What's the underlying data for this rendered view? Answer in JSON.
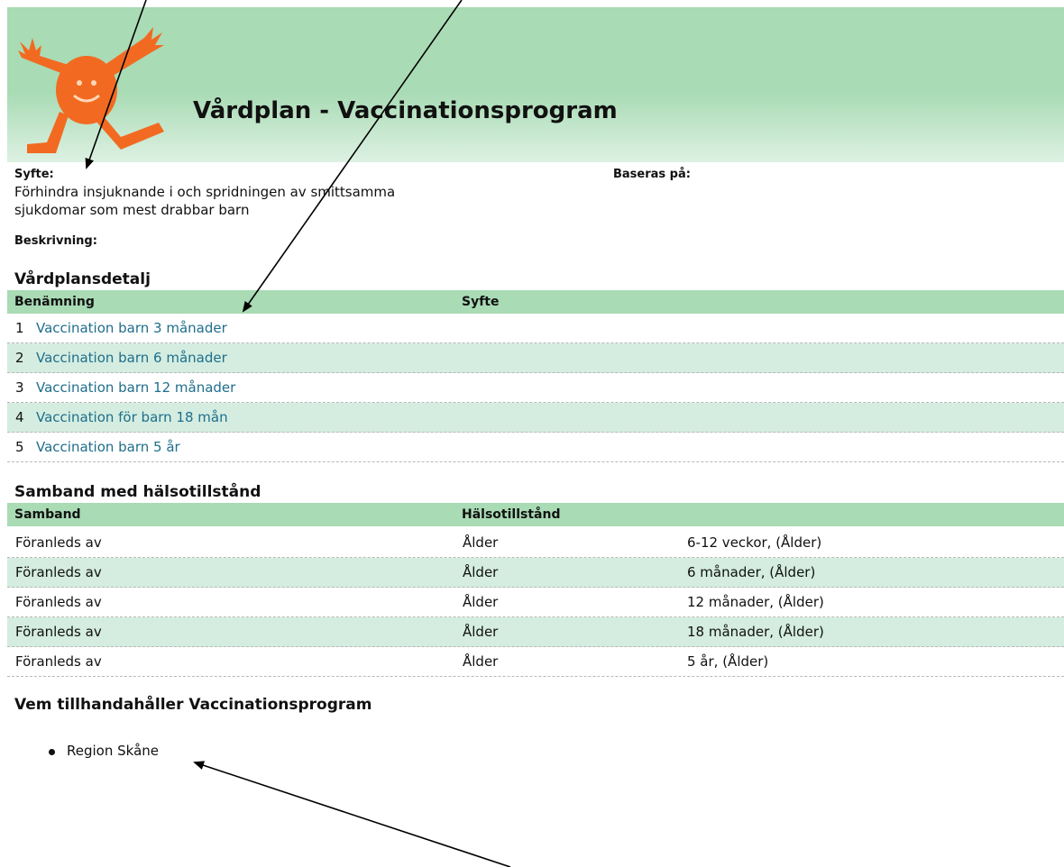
{
  "header": {
    "title": "Vårdplan - Vaccinationsprogram",
    "logo_icon": "orange-cheering-figure-logo",
    "bg_color": "#a9dbb5"
  },
  "info": {
    "syfte_label": "Syfte:",
    "syfte_text_line1": "Förhindra insjuknande i och spridningen av smittsamma",
    "syfte_text_line2": "sjukdomar som mest drabbar barn",
    "baseras_label": "Baseras på:",
    "beskrivning_label": "Beskrivning:"
  },
  "detail": {
    "title": "Vårdplansdetalj",
    "headers": [
      "Benämning",
      "Syfte"
    ],
    "rows": [
      {
        "num": "1",
        "name": "Vaccination barn 3 månader"
      },
      {
        "num": "2",
        "name": "Vaccination barn 6 månader"
      },
      {
        "num": "3",
        "name": "Vaccination barn 12 månader"
      },
      {
        "num": "4",
        "name": "Vaccination för barn 18 mån"
      },
      {
        "num": "5",
        "name": "Vaccination barn 5 år"
      }
    ]
  },
  "samband": {
    "title": "Samband med hälsotillstånd",
    "headers": [
      "Samband",
      "Hälsotillstånd"
    ],
    "rows": [
      {
        "relation": "Föranleds av",
        "condition": "Ålder",
        "value": "6-12 veckor, (Ålder)"
      },
      {
        "relation": "Föranleds av",
        "condition": "Ålder",
        "value": "6 månader, (Ålder)"
      },
      {
        "relation": "Föranleds av",
        "condition": "Ålder",
        "value": "12 månader, (Ålder)"
      },
      {
        "relation": "Föranleds av",
        "condition": "Ålder",
        "value": "18 månader, (Ålder)"
      },
      {
        "relation": "Föranleds av",
        "condition": "Ålder",
        "value": "5 år, (Ålder)"
      }
    ]
  },
  "providers": {
    "title": "Vem tillhandahåller Vaccinationsprogram",
    "items": [
      "Region Skåne"
    ]
  },
  "colors": {
    "accent_green": "#a9dbb5",
    "row_alt": "#d4ede0",
    "link": "#1f6e8c",
    "logo_orange": "#f26a21"
  }
}
